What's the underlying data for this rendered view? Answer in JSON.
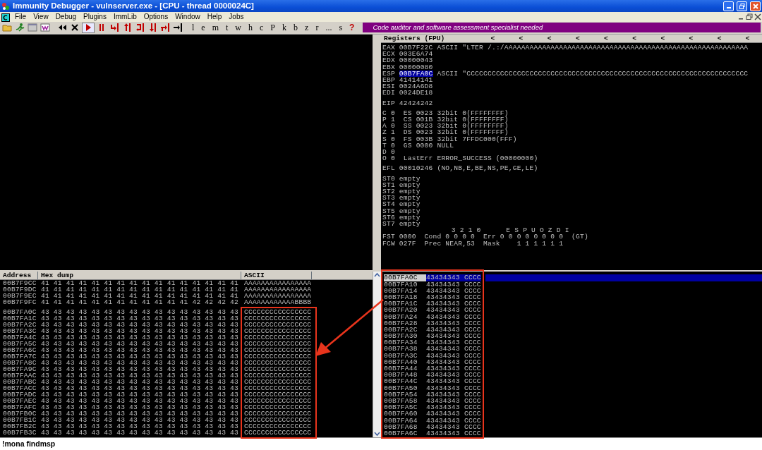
{
  "window": {
    "title": "Immunity Debugger - vulnserver.exe - [CPU - thread 0000024C]"
  },
  "menu": [
    "File",
    "View",
    "Debug",
    "Plugins",
    "ImmLib",
    "Options",
    "Window",
    "Help",
    "Jobs"
  ],
  "toolbar": {
    "buttons": [
      {
        "label": "l",
        "kind": "letter"
      },
      {
        "label": "e",
        "kind": "letter"
      },
      {
        "label": "m",
        "kind": "letter"
      },
      {
        "label": "t",
        "kind": "letter"
      },
      {
        "label": "w",
        "kind": "letter"
      },
      {
        "label": "h",
        "kind": "letter"
      },
      {
        "label": "c",
        "kind": "letter"
      },
      {
        "label": "P",
        "kind": "letter"
      },
      {
        "label": "k",
        "kind": "letter"
      },
      {
        "label": "b",
        "kind": "letter"
      },
      {
        "label": "z",
        "kind": "letter"
      },
      {
        "label": "r",
        "kind": "letter"
      },
      {
        "label": "...",
        "kind": "letter"
      },
      {
        "label": "s",
        "kind": "letter"
      },
      {
        "label": "?",
        "kind": "help"
      }
    ],
    "banner": "Code auditor and software assessment specialist needed"
  },
  "registers": {
    "title": "Registers (FPU)",
    "arrows": [
      "<",
      "<",
      "<",
      "<",
      "<",
      "<",
      "<",
      "<",
      "<",
      "<"
    ],
    "general": [
      {
        "name": "EAX",
        "value": "00B7F22C",
        "comment": "ASCII \"LTER /.:/AAAAAAAAAAAAAAAAAAAAAAAAAAAAAAAAAAAAAAAAAAAAAAAAAAAAAAAAAA",
        "selected": false
      },
      {
        "name": "ECX",
        "value": "003E6A74",
        "selected": false
      },
      {
        "name": "EDX",
        "value": "00000043",
        "selected": false
      },
      {
        "name": "EBX",
        "value": "00000080",
        "selected": false
      },
      {
        "name": "ESP",
        "value": "00B7FA0C",
        "comment": "ASCII \"CCCCCCCCCCCCCCCCCCCCCCCCCCCCCCCCCCCCCCCCCCCCCCCCCCCCCCCCCCCCCCCCCCC",
        "selected": true
      },
      {
        "name": "EBP",
        "value": "41414141",
        "selected": false
      },
      {
        "name": "ESI",
        "value": "0024A6D8",
        "selected": false
      },
      {
        "name": "EDI",
        "value": "0024DE18",
        "selected": false
      }
    ],
    "eip": {
      "name": "EIP",
      "value": "42424242"
    },
    "flags": [
      "C 0  ES 0023 32bit 0(FFFFFFFF)",
      "P 1  CS 001B 32bit 0(FFFFFFFF)",
      "A 0  SS 0023 32bit 0(FFFFFFFF)",
      "Z 1  DS 0023 32bit 0(FFFFFFFF)",
      "S 0  FS 003B 32bit 7FFDC000(FFF)",
      "T 0  GS 0000 NULL",
      "D 0",
      "O 0  LastErr ERROR_SUCCESS (00000000)"
    ],
    "efl": "EFL 00010246 (NO,NB,E,BE,NS,PE,GE,LE)",
    "fpu_stack": [
      "ST0 empty",
      "ST1 empty",
      "ST2 empty",
      "ST3 empty",
      "ST4 empty",
      "ST5 empty",
      "ST6 empty",
      "ST7 empty"
    ],
    "fpu_bits": "3 2 1 0      E S P U O Z D I",
    "fpu_status": [
      "FST 0000  Cond 0 0 0 0  Err 0 0 0 0 0 0 0 0  (GT)",
      "FCW 027F  Prec NEAR,53  Mask    1 1 1 1 1 1"
    ]
  },
  "dump": {
    "columns": [
      "Address",
      "Hex dump",
      "ASCII"
    ],
    "rows": [
      {
        "address": "00B7F9CC",
        "bytes": "41 41 41 41 41 41 41 41 41 41 41 41 41 41 41 41",
        "ascii": "AAAAAAAAAAAAAAAA"
      },
      {
        "address": "00B7F9DC",
        "bytes": "41 41 41 41 41 41 41 41 41 41 41 41 41 41 41 41",
        "ascii": "AAAAAAAAAAAAAAAA"
      },
      {
        "address": "00B7F9EC",
        "bytes": "41 41 41 41 41 41 41 41 41 41 41 41 41 41 41 41",
        "ascii": "AAAAAAAAAAAAAAAA"
      },
      {
        "address": "00B7F9FC",
        "bytes": "41 41 41 41 41 41 41 41 41 41 41 41 42 42 42 42",
        "ascii": "AAAAAAAAAAAABBBB"
      },
      {
        "address": "00B7FA0C",
        "bytes": "43 43 43 43 43 43 43 43 43 43 43 43 43 43 43 43",
        "ascii": "CCCCCCCCCCCCCCCC"
      },
      {
        "address": "00B7FA1C",
        "bytes": "43 43 43 43 43 43 43 43 43 43 43 43 43 43 43 43",
        "ascii": "CCCCCCCCCCCCCCCC"
      },
      {
        "address": "00B7FA2C",
        "bytes": "43 43 43 43 43 43 43 43 43 43 43 43 43 43 43 43",
        "ascii": "CCCCCCCCCCCCCCCC"
      },
      {
        "address": "00B7FA3C",
        "bytes": "43 43 43 43 43 43 43 43 43 43 43 43 43 43 43 43",
        "ascii": "CCCCCCCCCCCCCCCC"
      },
      {
        "address": "00B7FA4C",
        "bytes": "43 43 43 43 43 43 43 43 43 43 43 43 43 43 43 43",
        "ascii": "CCCCCCCCCCCCCCCC"
      },
      {
        "address": "00B7FA5C",
        "bytes": "43 43 43 43 43 43 43 43 43 43 43 43 43 43 43 43",
        "ascii": "CCCCCCCCCCCCCCCC"
      },
      {
        "address": "00B7FA6C",
        "bytes": "43 43 43 43 43 43 43 43 43 43 43 43 43 43 43 43",
        "ascii": "CCCCCCCCCCCCCCCC"
      },
      {
        "address": "00B7FA7C",
        "bytes": "43 43 43 43 43 43 43 43 43 43 43 43 43 43 43 43",
        "ascii": "CCCCCCCCCCCCCCCC"
      },
      {
        "address": "00B7FA8C",
        "bytes": "43 43 43 43 43 43 43 43 43 43 43 43 43 43 43 43",
        "ascii": "CCCCCCCCCCCCCCCC"
      },
      {
        "address": "00B7FA9C",
        "bytes": "43 43 43 43 43 43 43 43 43 43 43 43 43 43 43 43",
        "ascii": "CCCCCCCCCCCCCCCC"
      },
      {
        "address": "00B7FAAC",
        "bytes": "43 43 43 43 43 43 43 43 43 43 43 43 43 43 43 43",
        "ascii": "CCCCCCCCCCCCCCCC"
      },
      {
        "address": "00B7FABC",
        "bytes": "43 43 43 43 43 43 43 43 43 43 43 43 43 43 43 43",
        "ascii": "CCCCCCCCCCCCCCCC"
      },
      {
        "address": "00B7FACC",
        "bytes": "43 43 43 43 43 43 43 43 43 43 43 43 43 43 43 43",
        "ascii": "CCCCCCCCCCCCCCCC"
      },
      {
        "address": "00B7FADC",
        "bytes": "43 43 43 43 43 43 43 43 43 43 43 43 43 43 43 43",
        "ascii": "CCCCCCCCCCCCCCCC"
      },
      {
        "address": "00B7FAEC",
        "bytes": "43 43 43 43 43 43 43 43 43 43 43 43 43 43 43 43",
        "ascii": "CCCCCCCCCCCCCCCC"
      },
      {
        "address": "00B7FAFC",
        "bytes": "43 43 43 43 43 43 43 43 43 43 43 43 43 43 43 43",
        "ascii": "CCCCCCCCCCCCCCCC"
      },
      {
        "address": "00B7FB0C",
        "bytes": "43 43 43 43 43 43 43 43 43 43 43 43 43 43 43 43",
        "ascii": "CCCCCCCCCCCCCCCC"
      },
      {
        "address": "00B7FB1C",
        "bytes": "43 43 43 43 43 43 43 43 43 43 43 43 43 43 43 43",
        "ascii": "CCCCCCCCCCCCCCCC"
      },
      {
        "address": "00B7FB2C",
        "bytes": "43 43 43 43 43 43 43 43 43 43 43 43 43 43 43 43",
        "ascii": "CCCCCCCCCCCCCCCC"
      },
      {
        "address": "00B7FB3C",
        "bytes": "43 43 43 43 43 43 43 43 43 43 43 43 43 43 43 43",
        "ascii": "CCCCCCCCCCCCCCCC"
      }
    ]
  },
  "stack": {
    "rows": [
      {
        "address": "00B7FA0C",
        "value": "43434343",
        "ascii": "CCCC",
        "selected": true
      },
      {
        "address": "00B7FA10",
        "value": "43434343",
        "ascii": "CCCC",
        "selected": false
      },
      {
        "address": "00B7FA14",
        "value": "43434343",
        "ascii": "CCCC",
        "selected": false
      },
      {
        "address": "00B7FA18",
        "value": "43434343",
        "ascii": "CCCC",
        "selected": false
      },
      {
        "address": "00B7FA1C",
        "value": "43434343",
        "ascii": "CCCC",
        "selected": false
      },
      {
        "address": "00B7FA20",
        "value": "43434343",
        "ascii": "CCCC",
        "selected": false
      },
      {
        "address": "00B7FA24",
        "value": "43434343",
        "ascii": "CCCC",
        "selected": false
      },
      {
        "address": "00B7FA28",
        "value": "43434343",
        "ascii": "CCCC",
        "selected": false
      },
      {
        "address": "00B7FA2C",
        "value": "43434343",
        "ascii": "CCCC",
        "selected": false
      },
      {
        "address": "00B7FA30",
        "value": "43434343",
        "ascii": "CCCC",
        "selected": false
      },
      {
        "address": "00B7FA34",
        "value": "43434343",
        "ascii": "CCCC",
        "selected": false
      },
      {
        "address": "00B7FA38",
        "value": "43434343",
        "ascii": "CCCC",
        "selected": false
      },
      {
        "address": "00B7FA3C",
        "value": "43434343",
        "ascii": "CCCC",
        "selected": false
      },
      {
        "address": "00B7FA40",
        "value": "43434343",
        "ascii": "CCCC",
        "selected": false
      },
      {
        "address": "00B7FA44",
        "value": "43434343",
        "ascii": "CCCC",
        "selected": false
      },
      {
        "address": "00B7FA48",
        "value": "43434343",
        "ascii": "CCCC",
        "selected": false
      },
      {
        "address": "00B7FA4C",
        "value": "43434343",
        "ascii": "CCCC",
        "selected": false
      },
      {
        "address": "00B7FA50",
        "value": "43434343",
        "ascii": "CCCC",
        "selected": false
      },
      {
        "address": "00B7FA54",
        "value": "43434343",
        "ascii": "CCCC",
        "selected": false
      },
      {
        "address": "00B7FA58",
        "value": "43434343",
        "ascii": "CCCC",
        "selected": false
      },
      {
        "address": "00B7FA5C",
        "value": "43434343",
        "ascii": "CCCC",
        "selected": false
      },
      {
        "address": "00B7FA60",
        "value": "43434343",
        "ascii": "CCCC",
        "selected": false
      },
      {
        "address": "00B7FA64",
        "value": "43434343",
        "ascii": "CCCC",
        "selected": false
      },
      {
        "address": "00B7FA68",
        "value": "43434343",
        "ascii": "CCCC",
        "selected": false
      },
      {
        "address": "00B7FA6C",
        "value": "43434343",
        "ascii": "CCCC",
        "selected": false
      }
    ]
  },
  "command": {
    "value": "!mona findmsp"
  }
}
